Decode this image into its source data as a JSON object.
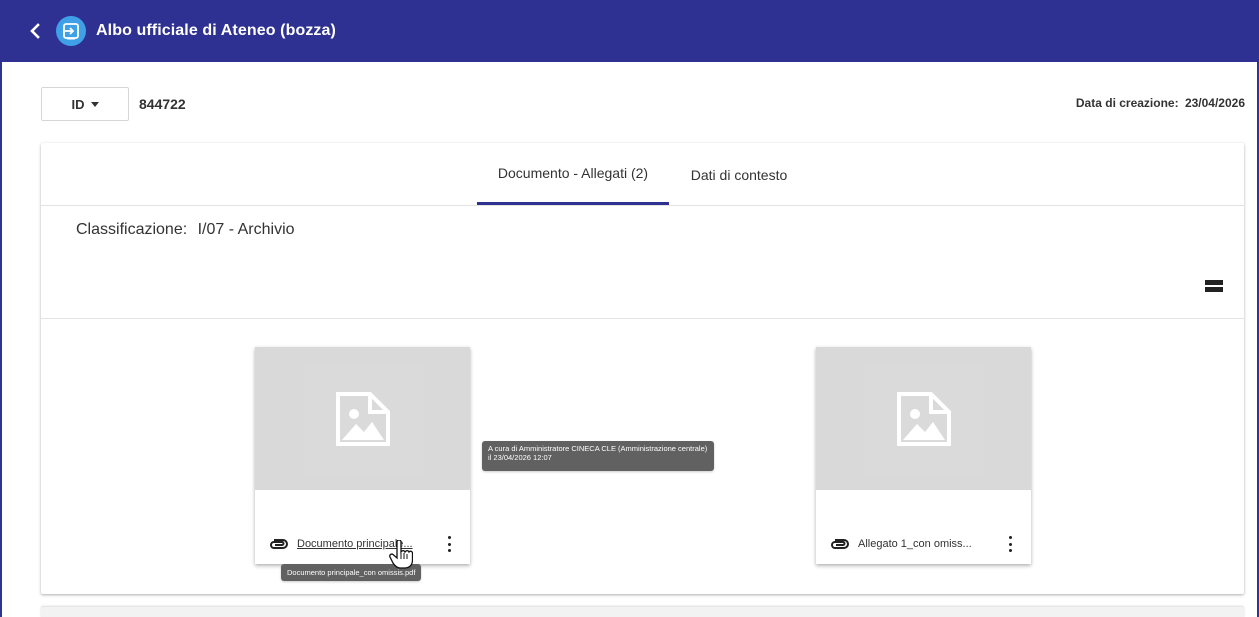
{
  "header": {
    "title": "Albo ufficiale di Ateneo (bozza)",
    "back_icon": "chevron-left-icon",
    "app_icon": "exit-to-app-icon",
    "bg_color": "#2e3192"
  },
  "record": {
    "id_selector_label": "ID",
    "id_value": "844722",
    "created_label": "Data di creazione:",
    "created_value": "23/04/2026"
  },
  "tabs": [
    {
      "label": "Documento - Allegati (2)",
      "active": true
    },
    {
      "label": "Dati di contesto",
      "active": false
    }
  ],
  "classification": {
    "label": "Classificazione:",
    "value": "I/07 - Archivio"
  },
  "documents": [
    {
      "name": "Documento principale...",
      "full_name_tooltip": "Documento principale_con omissis.pdf",
      "icon": "image-placeholder-icon"
    },
    {
      "name": "Allegato 1_con omiss...",
      "icon": "image-placeholder-icon"
    }
  ],
  "tooltips": {
    "author": "A cura di Amministratore CINECA CLE (Amministrazione centrale) il 23/04/2026 12:07",
    "filename": "Documento principale_con omissis.pdf"
  }
}
